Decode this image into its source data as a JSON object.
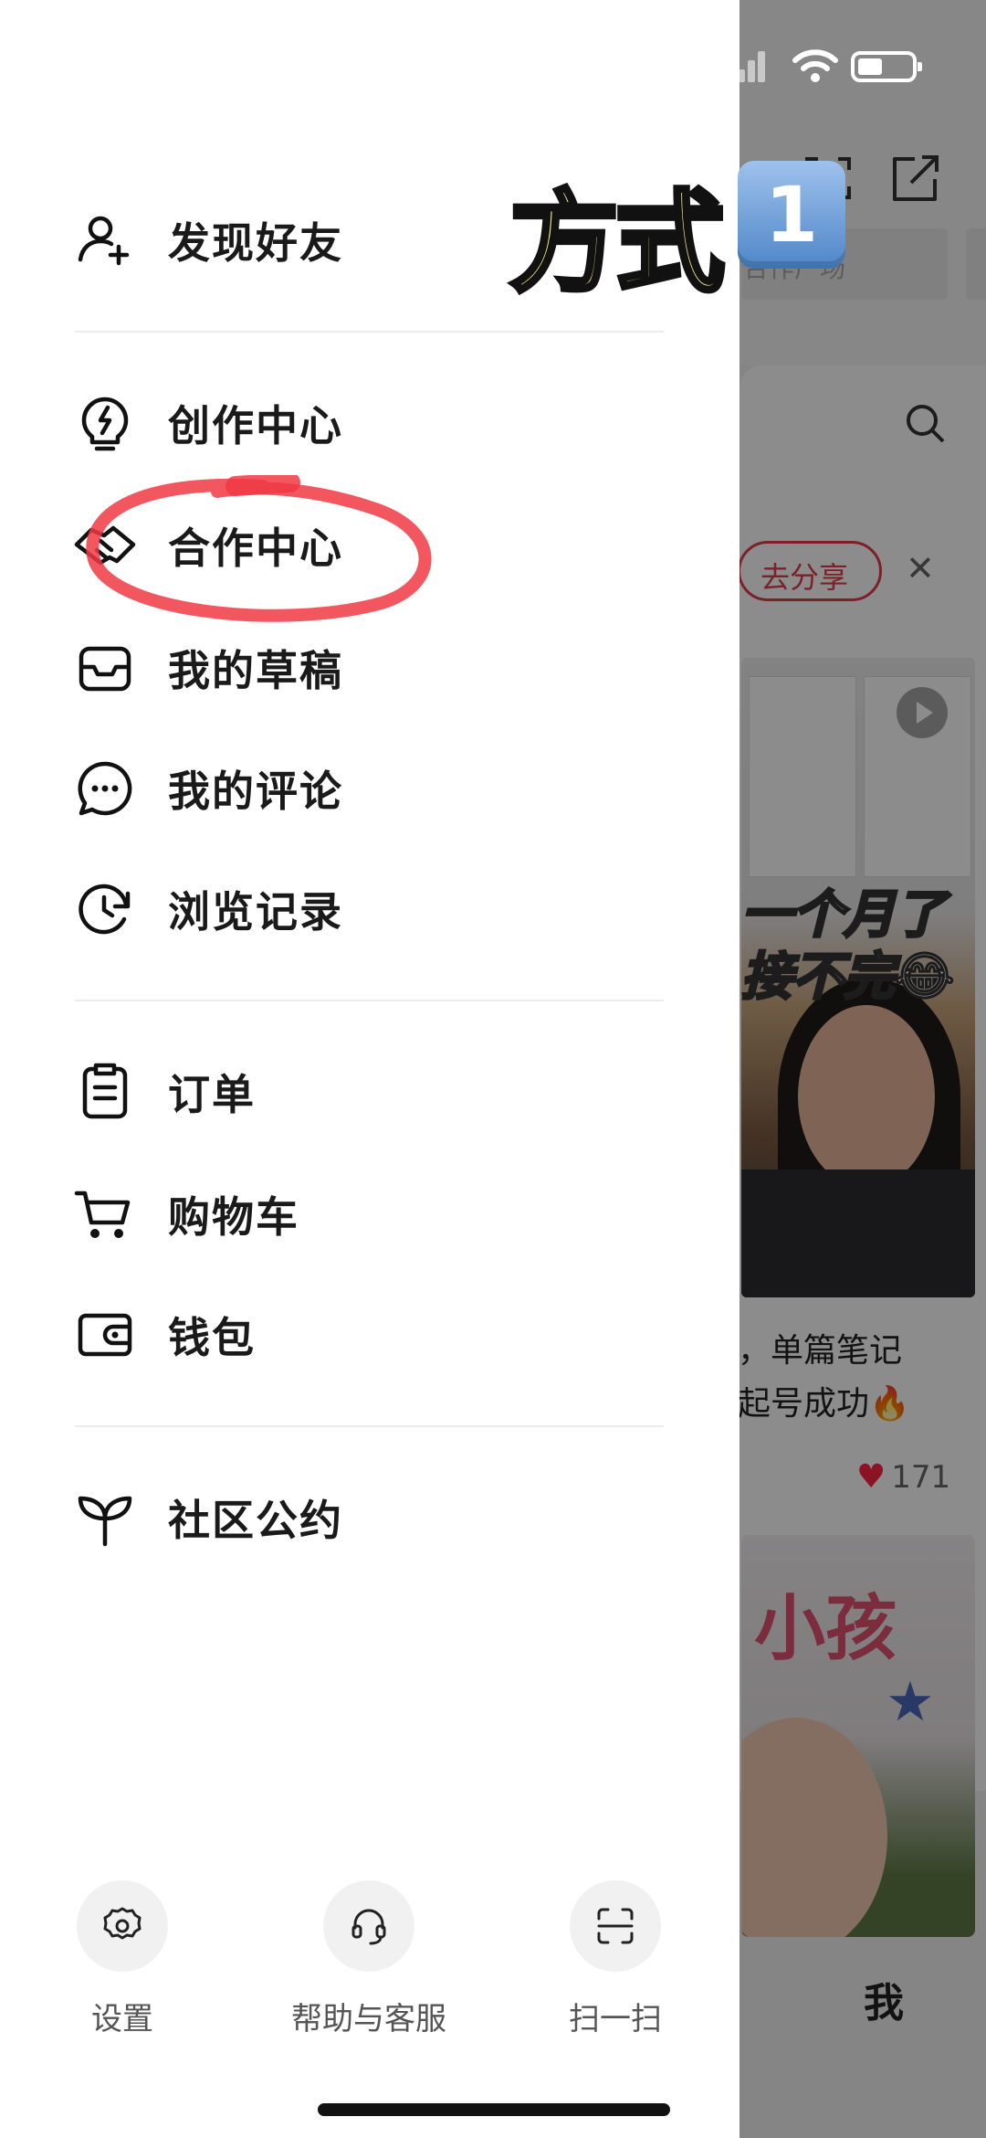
{
  "background": {
    "search_placeholder": "合作广场",
    "share_button": "去分享",
    "close_symbol": "✕",
    "note_overlay_line1": "一个月了",
    "note_overlay_line2": "接不完😂",
    "note_caption_line1": "，单篇笔记",
    "note_caption_line2": "起号成功🔥",
    "note_likes": "171",
    "card2_title": "小孩",
    "tab_me": "我"
  },
  "drawer": {
    "groups": [
      {
        "items": [
          {
            "label": "发现好友",
            "icon": "add-friend-icon"
          }
        ]
      },
      {
        "items": [
          {
            "label": "创作中心",
            "icon": "lightning-bulb-icon"
          },
          {
            "label": "合作中心",
            "icon": "handshake-icon"
          },
          {
            "label": "我的草稿",
            "icon": "inbox-icon"
          },
          {
            "label": "我的评论",
            "icon": "chat-bubble-icon"
          },
          {
            "label": "浏览记录",
            "icon": "history-clock-icon"
          }
        ]
      },
      {
        "items": [
          {
            "label": "订单",
            "icon": "order-clipboard-icon"
          },
          {
            "label": "购物车",
            "icon": "shopping-cart-icon"
          },
          {
            "label": "钱包",
            "icon": "wallet-icon"
          }
        ]
      },
      {
        "items": [
          {
            "label": "社区公约",
            "icon": "sprout-icon"
          }
        ]
      }
    ],
    "bottom_buttons": [
      {
        "label": "设置",
        "icon": "gear-icon"
      },
      {
        "label": "帮助与客服",
        "icon": "headset-icon"
      },
      {
        "label": "扫一扫",
        "icon": "scan-icon"
      }
    ]
  },
  "annotation": {
    "title": "方式",
    "badge": "1",
    "highlight_color": "#f03a44"
  }
}
